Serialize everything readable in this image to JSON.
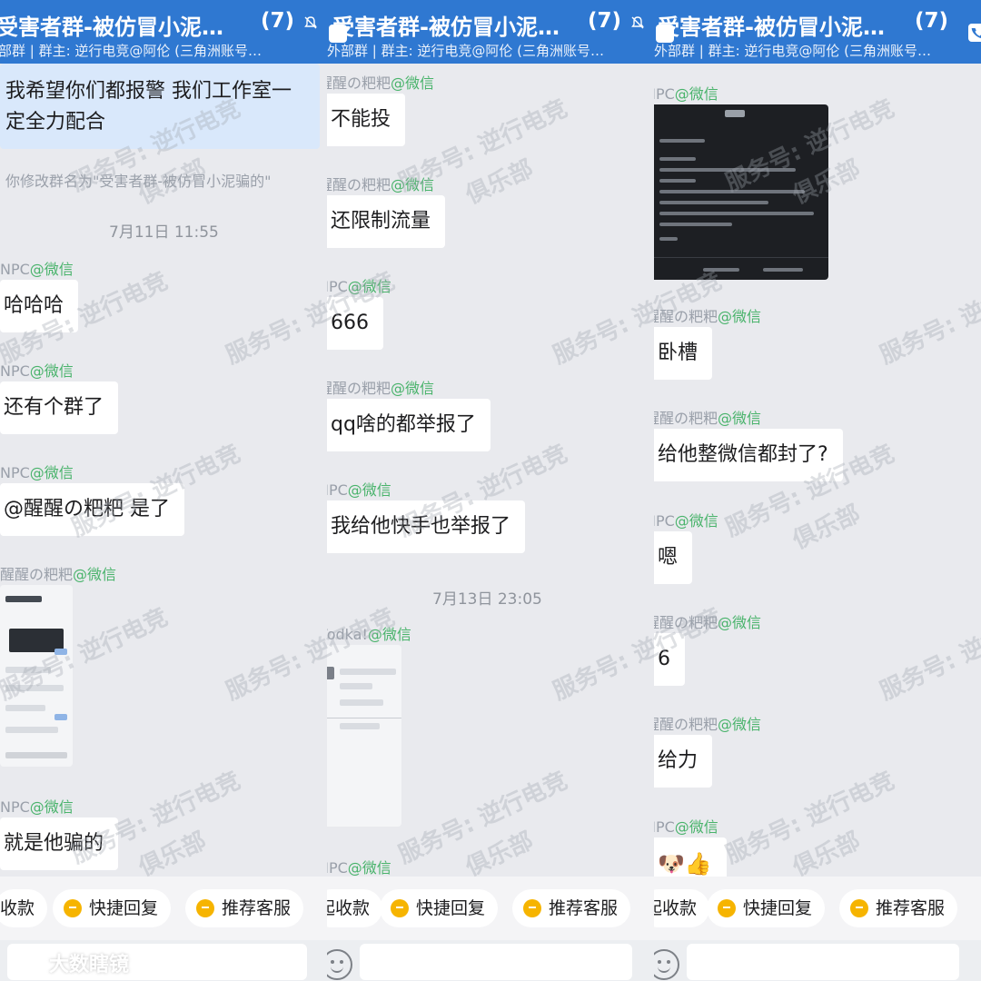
{
  "panels": [
    {
      "title": "受害者群-被仿冒小泥…",
      "count": "(7)",
      "subtitle": "部群 | 群主: 逆行电竞@阿伦 (三角洲账号…",
      "messages": {
        "m1_text": "我希望你们都报警 我们工作室一定全力配合",
        "system": "你修改群名为\"受害者群-被仿冒小泥骗的\"",
        "time": "7月11日 11:55",
        "s2_name": "NPC",
        "s2_tag": "@微信",
        "m2_text": "哈哈哈",
        "s3_name": "NPC",
        "s3_tag": "@微信",
        "m3_text": "还有个群了",
        "s4_name": "NPC",
        "s4_tag": "@微信",
        "m4_text": "@醒醒の粑粑 是了",
        "s5_name": "醒醒の粑粑",
        "s5_tag": "@微信",
        "s6_name": "NPC",
        "s6_tag": "@微信",
        "m6_text": "就是他骗的"
      },
      "chips": [
        "收款",
        "快捷回复",
        "推荐客服"
      ]
    },
    {
      "title": "受害者群-被仿冒小泥…",
      "count": "(7)",
      "subtitle": "外部群 | 群主: 逆行电竞@阿伦 (三角洲账号…",
      "messages": {
        "s1_name": "醒醒の粑粑",
        "s1_tag": "@微信",
        "m1_text": "不能投",
        "s2_name": "醒醒の粑粑",
        "s2_tag": "@微信",
        "m2_text": "还限制流量",
        "s3_name": "NPC",
        "s3_tag": "@微信",
        "m3_text": "666",
        "s4_name": "醒醒の粑粑",
        "s4_tag": "@微信",
        "m4_text": "qq啥的都举报了",
        "s5_name": "NPC",
        "s5_tag": "@微信",
        "m5_text": "我给他快手也举报了",
        "time": "7月13日 23:05",
        "s6_name": "Vodka!",
        "s6_tag": "@微信",
        "s7_name": "NPC",
        "s7_tag": "@微信"
      },
      "chips": [
        "起收款",
        "快捷回复",
        "推荐客服"
      ]
    },
    {
      "title": "受害者群-被仿冒小泥…",
      "count": "(7)",
      "subtitle": "外部群 | 群主: 逆行电竞@阿伦 (三角洲账号…",
      "messages": {
        "s1_name": "NPC",
        "s1_tag": "@微信",
        "s2_name": "醒醒の粑粑",
        "s2_tag": "@微信",
        "m2_text": "卧槽",
        "s3_name": "醒醒の粑粑",
        "s3_tag": "@微信",
        "m3_text": "给他整微信都封了?",
        "s4_name": "NPC",
        "s4_tag": "@微信",
        "m4_text": "嗯",
        "s5_name": "醒醒の粑粑",
        "s5_tag": "@微信",
        "m5_text": "6",
        "s6_name": "醒醒の粑粑",
        "s6_tag": "@微信",
        "m6_text": "给力",
        "s7_name": "NPC",
        "s7_tag": "@微信",
        "m7_text": "🐶👍"
      },
      "chips": [
        "起收款",
        "快捷回复",
        "推荐客服"
      ]
    }
  ],
  "watermark": {
    "line1": "服务号: 逆行电竞",
    "line2": "俱乐部"
  },
  "brand": "大数瞎镜",
  "colors": {
    "header": "#2f78d1",
    "sender_tag": "#49b36b",
    "background": "#e9eaee"
  }
}
